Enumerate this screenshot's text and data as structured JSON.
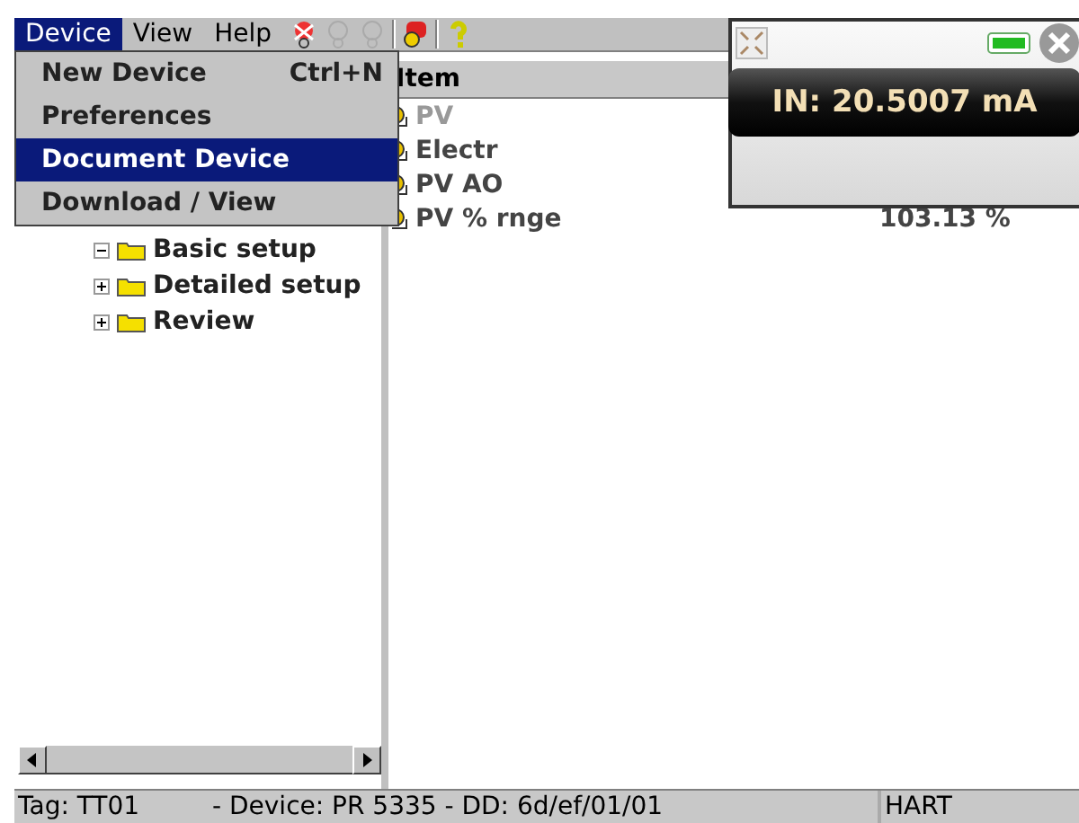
{
  "menubar": [
    {
      "label": "Device",
      "selected": true
    },
    {
      "label": "View",
      "selected": false
    },
    {
      "label": "Help",
      "selected": false
    }
  ],
  "toolbar": [
    {
      "kind": "connect",
      "disabled": false
    },
    {
      "kind": "query",
      "disabled": true
    },
    {
      "kind": "query",
      "disabled": true
    },
    {
      "kind": "device",
      "disabled": false
    },
    {
      "kind": "help",
      "disabled": false
    }
  ],
  "device_menu": [
    {
      "label": "New Device",
      "shortcut": "Ctrl+N",
      "selected": false
    },
    {
      "label": "Preferences",
      "selected": false
    },
    {
      "label": "Document Device",
      "selected": true
    },
    {
      "label": "Download / View",
      "selected": false
    }
  ],
  "tree": [
    {
      "label": "Basic setup",
      "expanded": true
    },
    {
      "label": "Detailed setup",
      "expanded": false
    },
    {
      "label": "Review",
      "expanded": false
    }
  ],
  "table": {
    "columns": [
      "Item"
    ],
    "rows": [
      {
        "item": "PV",
        "disabled": true
      },
      {
        "item": "Electr",
        "disabled": false
      },
      {
        "item": "PV AO",
        "disabled": false
      },
      {
        "item": "PV % rnge",
        "value": "103.13 %",
        "disabled": false
      }
    ]
  },
  "reading_popup": {
    "reading": "IN: 20.5007 mA"
  },
  "status_bar": {
    "tag": "Tag: TT01",
    "device": "- Device: PR 5335 - DD: 6d/ef/01/01",
    "protocol": "HART"
  }
}
